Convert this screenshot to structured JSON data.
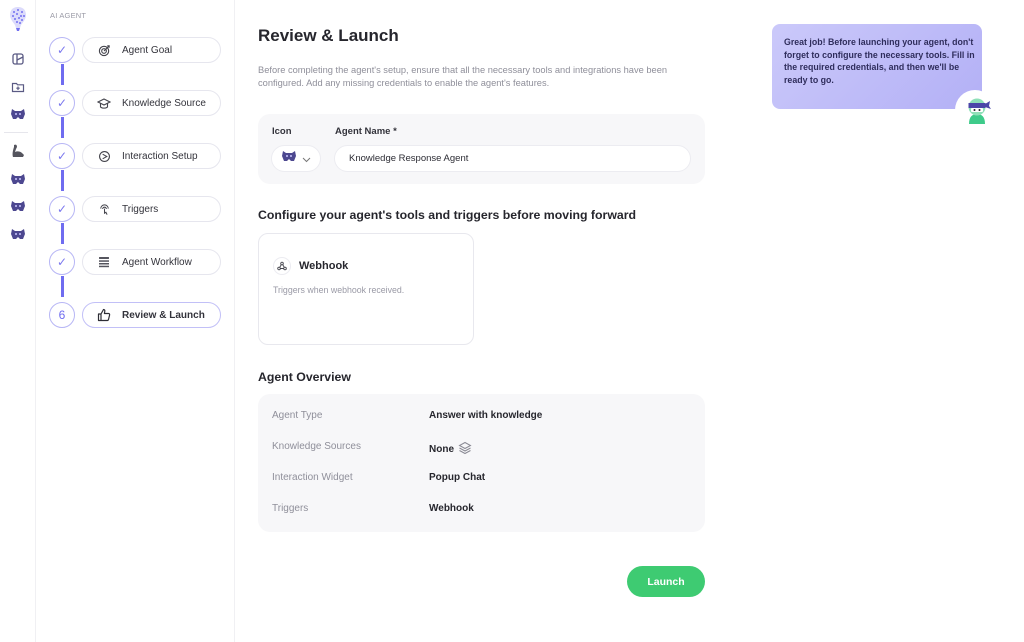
{
  "rail": {
    "items": [
      {
        "name": "logo",
        "icon": "brain-logo-icon"
      },
      {
        "name": "dashboard",
        "icon": "dashboard-icon"
      },
      {
        "name": "new-folder",
        "icon": "folder-plus-icon"
      },
      {
        "name": "agent-1",
        "icon": "agent-avatar-icon"
      },
      {
        "name": "strength",
        "icon": "flexed-arm-icon"
      },
      {
        "name": "agent-2",
        "icon": "agent-avatar-icon"
      },
      {
        "name": "agent-3",
        "icon": "agent-avatar-icon"
      },
      {
        "name": "agent-4",
        "icon": "agent-avatar-icon"
      }
    ]
  },
  "steps": {
    "title": "AI AGENT",
    "items": [
      {
        "label": "Agent Goal",
        "status": "done",
        "marker": "✓",
        "icon": "target-icon"
      },
      {
        "label": "Knowledge Source",
        "status": "done",
        "marker": "✓",
        "icon": "graduation-cap-icon"
      },
      {
        "label": "Interaction Setup",
        "status": "done",
        "marker": "✓",
        "icon": "chat-widget-icon"
      },
      {
        "label": "Triggers",
        "status": "done",
        "marker": "✓",
        "icon": "tap-icon"
      },
      {
        "label": "Agent Workflow",
        "status": "done",
        "marker": "✓",
        "icon": "list-icon"
      },
      {
        "label": "Review & Launch",
        "status": "active",
        "marker": "6",
        "icon": "thumbs-up-icon"
      }
    ]
  },
  "main": {
    "title": "Review & Launch",
    "description": "Before completing the agent's setup, ensure that all the necessary tools and integrations have been configured. Add any missing credentials to enable the agent's features.",
    "icon_label": "Icon",
    "name_label": "Agent Name *",
    "name_value": "Knowledge Response Agent",
    "config_title": "Configure your agent's tools and triggers before moving forward",
    "tool": {
      "name": "Webhook",
      "description": "Triggers when webhook received."
    },
    "overview_title": "Agent Overview",
    "overview": [
      {
        "key": "Agent Type",
        "value": "Answer with knowledge"
      },
      {
        "key": "Knowledge Sources",
        "value": "None"
      },
      {
        "key": "Interaction Widget",
        "value": "Popup Chat"
      },
      {
        "key": "Triggers",
        "value": "Webhook"
      }
    ],
    "launch_label": "Launch"
  },
  "assistant": {
    "message": "Great job! Before launching your agent, don't forget to configure the necessary tools. Fill in the required credentials, and then we'll be ready to go."
  },
  "colors": {
    "accent": "#6f6cf0",
    "launch": "#3ecb72",
    "bubble": "#b3b0f6"
  }
}
